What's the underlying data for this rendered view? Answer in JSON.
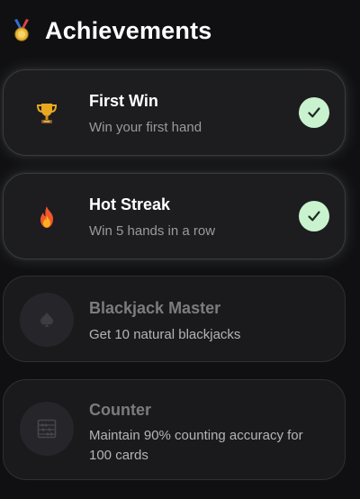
{
  "header": {
    "icon": "medal-icon",
    "title": "Achievements"
  },
  "achievements": [
    {
      "icon": "trophy-icon",
      "title": "First Win",
      "description": "Win your first hand",
      "unlocked": true
    },
    {
      "icon": "fire-icon",
      "title": "Hot Streak",
      "description": "Win 5 hands in a row",
      "unlocked": true
    },
    {
      "icon": "spade-icon",
      "title": "Blackjack Master",
      "description": "Get 10 natural blackjacks",
      "unlocked": false
    },
    {
      "icon": "abacus-icon",
      "title": "Counter",
      "description": "Maintain 90% counting accuracy for 100 cards",
      "unlocked": false
    }
  ],
  "colors": {
    "background": "#101012",
    "card": "#1d1d20",
    "check": "#c9f2cf",
    "locked_title": "#7b7b80"
  }
}
